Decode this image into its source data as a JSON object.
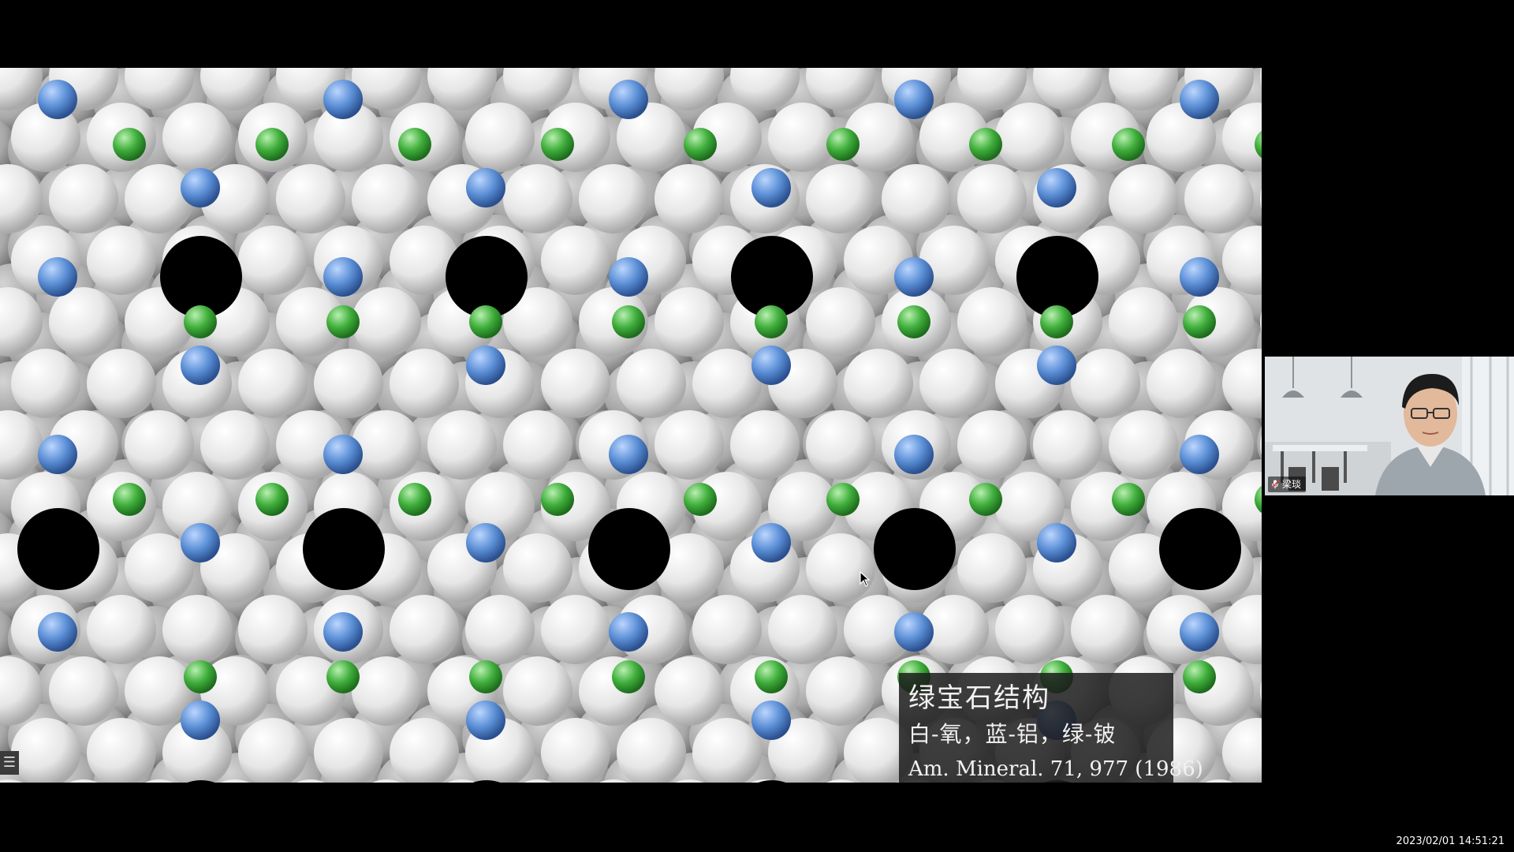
{
  "slide": {
    "title": "绿宝石结构",
    "legend_line": "白-氧，蓝-铝，绿-铍",
    "reference": "Am. Mineral. 71, 977 (1986)",
    "colors": {
      "oxygen": "#f2f2f2",
      "aluminum": "#5b8fd6",
      "beryllium": "#3fae3b"
    }
  },
  "side_panel": {
    "icon": "list-icon",
    "glyph": "☰"
  },
  "participant": {
    "name": "梁琰"
  },
  "timestamp": "2023/02/01 14:51:21"
}
